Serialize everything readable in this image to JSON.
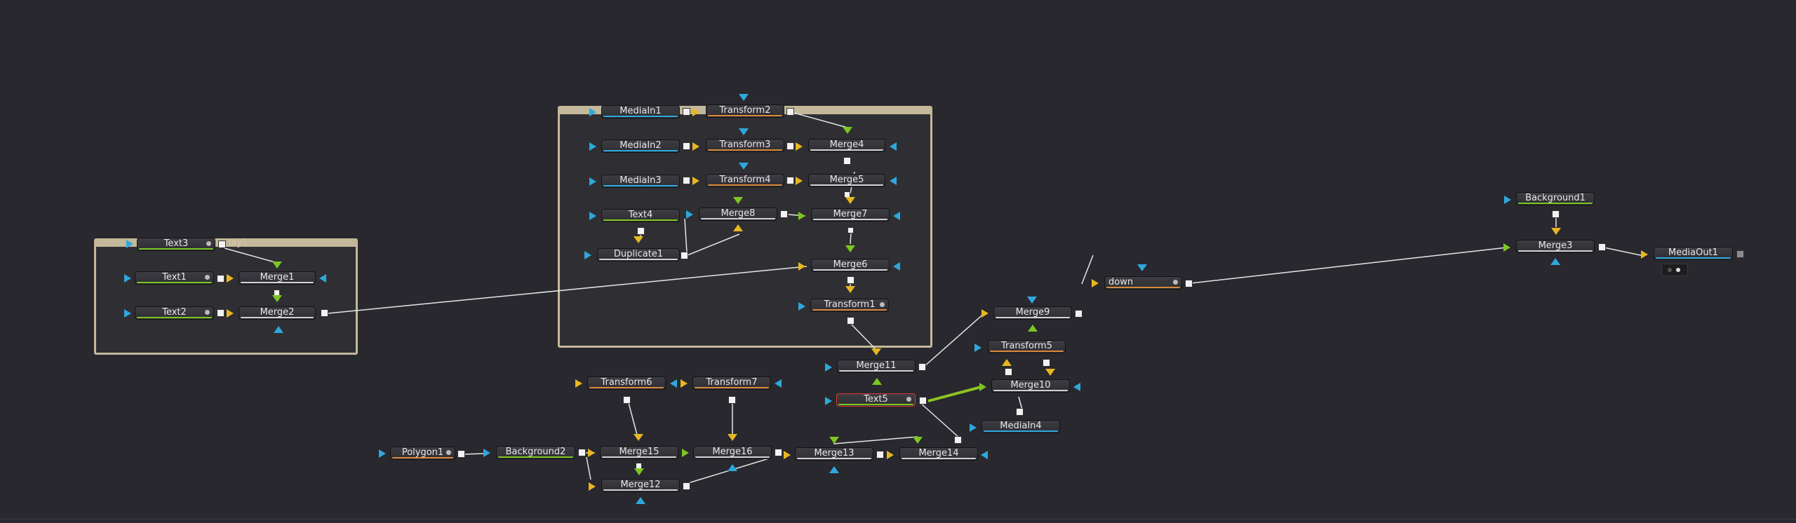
{
  "colors": {
    "blue": "#2ea8dc",
    "yellow": "#e8b622",
    "green": "#7cc622",
    "orange": "#d9883a",
    "white": "#f2f2f2"
  },
  "groups": {
    "group1_label": "lay1"
  },
  "nodes": {
    "MediaIn1": "MediaIn1",
    "MediaIn2": "MediaIn2",
    "MediaIn3": "MediaIn3",
    "MediaIn4": "MediaIn4",
    "Transform1": "Transform1",
    "Transform2": "Transform2",
    "Transform3": "Transform3",
    "Transform4": "Transform4",
    "Transform5": "Transform5",
    "Transform6": "Transform6",
    "Transform7": "Transform7",
    "Merge1": "Merge1",
    "Merge2": "Merge2",
    "Merge3": "Merge3",
    "Merge4": "Merge4",
    "Merge5": "Merge5",
    "Merge6": "Merge6",
    "Merge7": "Merge7",
    "Merge8": "Merge8",
    "Merge9": "Merge9",
    "Merge10": "Merge10",
    "Merge11": "Merge11",
    "Merge12": "Merge12",
    "Merge13": "Merge13",
    "Merge14": "Merge14",
    "Merge15": "Merge15",
    "Merge16": "Merge16",
    "Text1": "Text1",
    "Text2": "Text2",
    "Text3": "Text3",
    "Text4": "Text4",
    "Text5": "Text5",
    "Duplicate1": "Duplicate1",
    "Polygon1": "Polygon1",
    "Background1": "Background1",
    "Background2": "Background2",
    "down": "down",
    "MediaOut1": "MediaOut1"
  }
}
